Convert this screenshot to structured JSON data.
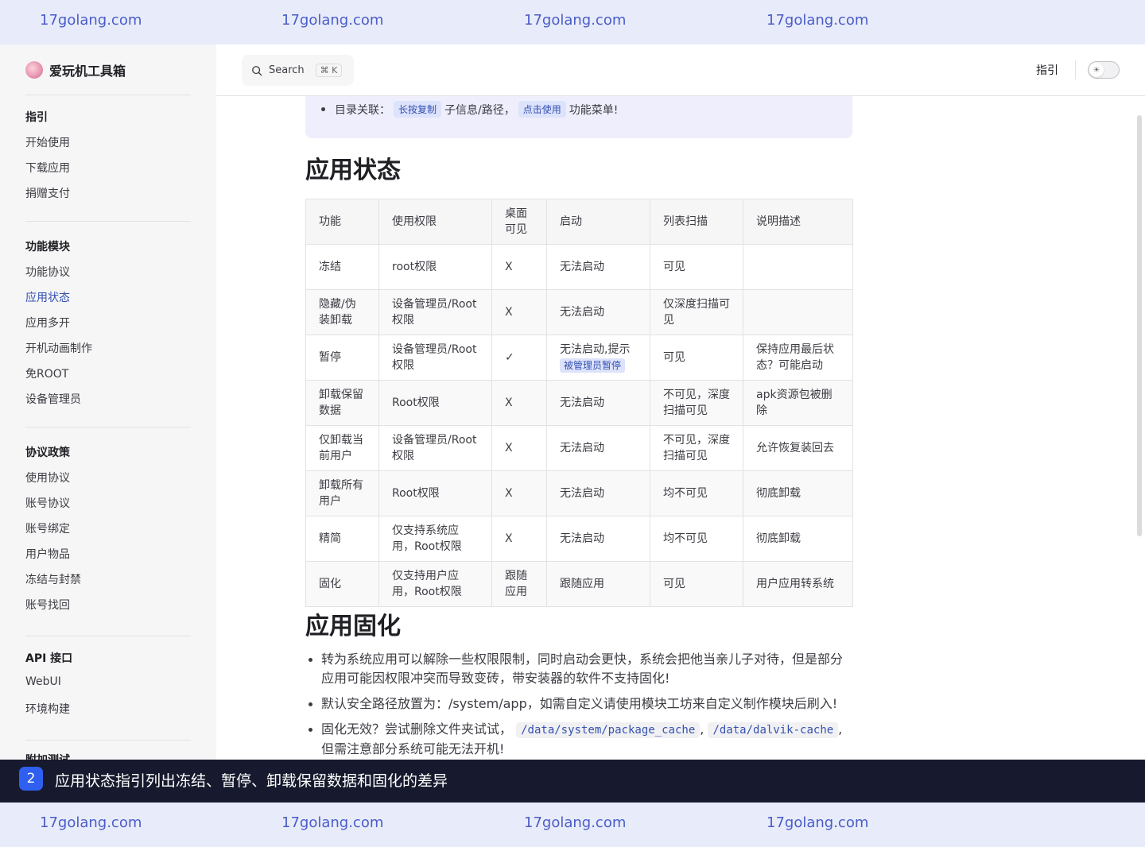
{
  "watermarks": [
    "17golang.com",
    "17golang.com",
    "17golang.com",
    "17golang.com"
  ],
  "sidebar": {
    "brand": "爱玩机工具箱",
    "groups": [
      {
        "title": "指引",
        "items": [
          "开始使用",
          "下载应用",
          "捐赠支付"
        ]
      },
      {
        "title": "功能模块",
        "items": [
          "功能协议",
          "应用状态",
          "应用多开",
          "开机动画制作",
          "免ROOT",
          "设备管理员"
        ],
        "active": "应用状态"
      },
      {
        "title": "协议政策",
        "items": [
          "使用协议",
          "账号协议",
          "账号绑定",
          "用户物品",
          "冻结与封禁",
          "账号找回"
        ]
      },
      {
        "title": "API 接口",
        "items": [
          "WebUI",
          "环境构建"
        ]
      },
      {
        "title": "附加测试",
        "items": []
      }
    ]
  },
  "topbar": {
    "search_label": "Search",
    "search_shortcut": "⌘ K",
    "nav_guide": "指引",
    "theme_toggle_icon": "sun-icon"
  },
  "tip": {
    "prefix": "目录关联：",
    "chip1": "长按复制",
    "middle": "子信息/路径，",
    "chip2": "点击使用",
    "suffix": "功能菜单!"
  },
  "section_status": {
    "title": "应用状态",
    "headers": [
      "功能",
      "使用权限",
      "桌面可见",
      "启动",
      "列表扫描",
      "说明描述"
    ],
    "rows": [
      {
        "feature": "冻结",
        "permission": "root权限",
        "desktop": "X",
        "launch": "无法启动",
        "launch_chip": "",
        "scan": "可见",
        "desc": ""
      },
      {
        "feature": "隐藏/伪装卸载",
        "permission": "设备管理员/Root权限",
        "desktop": "X",
        "launch": "无法启动",
        "launch_chip": "",
        "scan": "仅深度扫描可见",
        "desc": ""
      },
      {
        "feature": "暂停",
        "permission": "设备管理员/Root权限",
        "desktop": "✓",
        "launch": "无法启动,提示",
        "launch_chip": "被管理员暂停",
        "scan": "可见",
        "desc": "保持应用最后状态？可能启动"
      },
      {
        "feature": "卸载保留数据",
        "permission": "Root权限",
        "desktop": "X",
        "launch": "无法启动",
        "launch_chip": "",
        "scan": "不可见，深度扫描可见",
        "desc": "apk资源包被删除"
      },
      {
        "feature": "仅卸载当前用户",
        "permission": "设备管理员/Root权限",
        "desktop": "X",
        "launch": "无法启动",
        "launch_chip": "",
        "scan": "不可见，深度扫描可见",
        "desc": "允许恢复装回去"
      },
      {
        "feature": "卸载所有用户",
        "permission": "Root权限",
        "desktop": "X",
        "launch": "无法启动",
        "launch_chip": "",
        "scan": "均不可见",
        "desc": "彻底卸载"
      },
      {
        "feature": "精简",
        "permission": "仅支持系统应用，Root权限",
        "desktop": "X",
        "launch": "无法启动",
        "launch_chip": "",
        "scan": "均不可见",
        "desc": "彻底卸载"
      },
      {
        "feature": "固化",
        "permission": "仅支持用户应用，Root权限",
        "desktop": "跟随应用",
        "launch": "跟随应用",
        "launch_chip": "",
        "scan": "可见",
        "desc": "用户应用转系统"
      }
    ]
  },
  "section_solid": {
    "title": "应用固化",
    "items": [
      "转为系统应用可以解除一些权限限制，同时启动会更快，系统会把他当亲儿子对待，但是部分应用可能因权限冲突而导致变砖，带安装器的软件不支持固化!",
      "默认安全路径放置为：/system/app，如需自定义请使用模块工坊来自定义制作模块后刷入!"
    ],
    "last_item_prefix": "固化无效？尝试删除文件夹试试，",
    "path1": "/data/system/package_cache",
    "sep": ",",
    "path2": "/data/dalvik-cache",
    "last_item_suffix": ",但需注意部分系统可能无法开机!"
  },
  "caption": {
    "badge": "2",
    "text": "应用状态指引列出冻结、暂停、卸载保留数据和固化的差异"
  },
  "colors": {
    "accent": "#3451b2",
    "tip_bg": "#eeeefd",
    "caption_bg": "#171a2e",
    "watermark_bg": "#e8ecfa"
  }
}
